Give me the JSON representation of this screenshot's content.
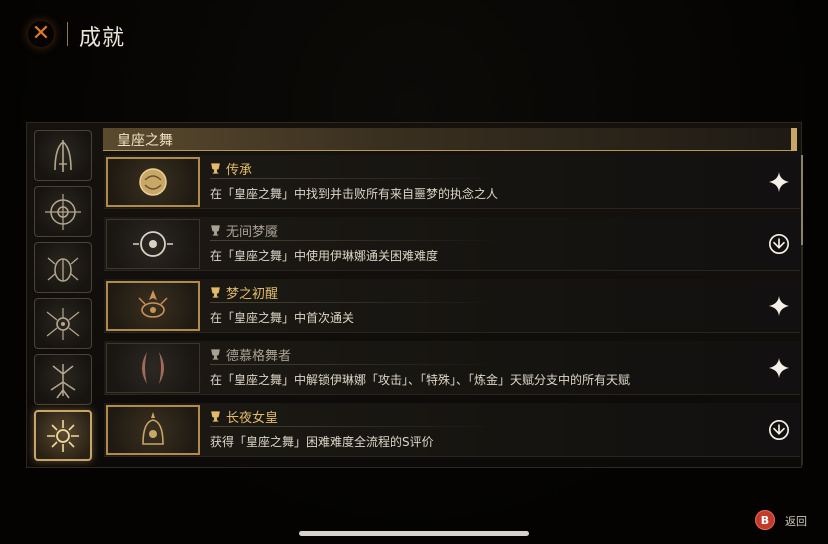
{
  "header": {
    "title": "成就",
    "close_icon": "close-x-icon"
  },
  "categories": [
    {
      "icon": "arch-emblem-icon",
      "active": false
    },
    {
      "icon": "compass-sigil-icon",
      "active": false
    },
    {
      "icon": "scarab-emblem-icon",
      "active": false
    },
    {
      "icon": "eye-spider-icon",
      "active": false
    },
    {
      "icon": "tree-root-icon",
      "active": false
    },
    {
      "icon": "sun-crown-icon",
      "active": true
    }
  ],
  "section": {
    "title": "皇座之舞"
  },
  "achievements": [
    {
      "name": "传承",
      "description": "在「皇座之舞」中找到并击败所有来自噩梦的执念之人",
      "unlocked": true,
      "status_icon": "sparkle-icon",
      "thumb_icon": "golden-orb-icon"
    },
    {
      "name": "无间梦魇",
      "description": "在「皇座之舞」中使用伊琳娜通关困难难度",
      "unlocked": false,
      "status_icon": "emblem-badge-icon",
      "thumb_icon": "eye-ring-icon"
    },
    {
      "name": "梦之初醒",
      "description": "在「皇座之舞」中首次通关",
      "unlocked": true,
      "status_icon": "sparkle-icon",
      "thumb_icon": "flame-eye-icon"
    },
    {
      "name": "德慕格舞者",
      "description": "在「皇座之舞」中解锁伊琳娜「攻击」、「特殊」、「炼金」天赋分支中的所有天赋",
      "unlocked": false,
      "status_icon": "sparkle-icon",
      "thumb_icon": "crescent-twin-icon"
    },
    {
      "name": "长夜女皇",
      "description": "获得「皇座之舞」困难难度全流程的S评价",
      "unlocked": true,
      "status_icon": "emblem-badge-icon",
      "thumb_icon": "crowned-bell-icon"
    }
  ],
  "footer": {
    "back_button_key": "B",
    "back_label": "返回"
  },
  "colors": {
    "gold_accent": "#c8a56a",
    "unlocked_name": "#e2bb6a",
    "locked_name": "#a9a193",
    "close_orange": "#e07a2a",
    "back_red": "#c23a2a"
  }
}
